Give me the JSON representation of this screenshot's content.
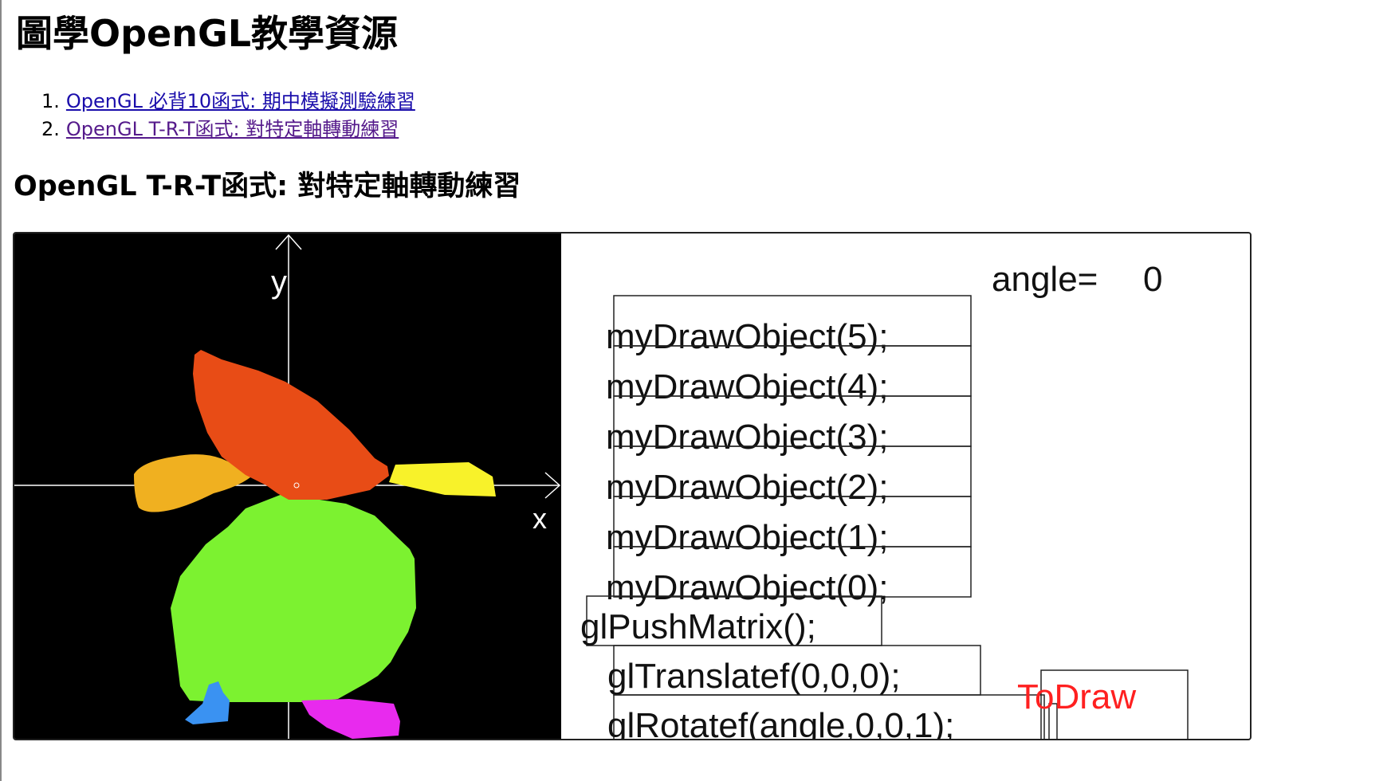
{
  "page": {
    "title": "圖學OpenGL教學資源"
  },
  "links": [
    {
      "number": "1.",
      "label": "OpenGL 必背10函式: 期中模擬測驗練習",
      "visited": false
    },
    {
      "number": "2.",
      "label": "OpenGL T-R-T函式: 對特定軸轉動練習",
      "visited": true
    }
  ],
  "section": {
    "title": "OpenGL T-R-T函式: 對特定軸轉動練習"
  },
  "viewport": {
    "background_color": "#000000",
    "axis_color": "#ffffff",
    "x_label": "x",
    "y_label": "y",
    "parts": [
      {
        "name": "head",
        "color": "#e84c16"
      },
      {
        "name": "left-arm",
        "color": "#f0b020"
      },
      {
        "name": "right-arm",
        "color": "#f8f22a"
      },
      {
        "name": "body",
        "color": "#7cf230"
      },
      {
        "name": "left-foot",
        "color": "#3a92f2"
      },
      {
        "name": "right-foot",
        "color": "#e82aee"
      }
    ]
  },
  "code_panel": {
    "angle_label": "angle=",
    "angle_value": "0",
    "stack_blocks": [
      "myDrawObject(5);",
      "myDrawObject(4);",
      "myDrawObject(3);",
      "myDrawObject(2);",
      "myDrawObject(1);",
      "myDrawObject(0);"
    ],
    "push_matrix": "glPushMatrix();",
    "translate": "glTranslatef(0,0,0);",
    "rotate": "glRotatef(angle,0,0,1);",
    "todraw_label": "ToDraw",
    "todraw_color": "#ff2020"
  }
}
